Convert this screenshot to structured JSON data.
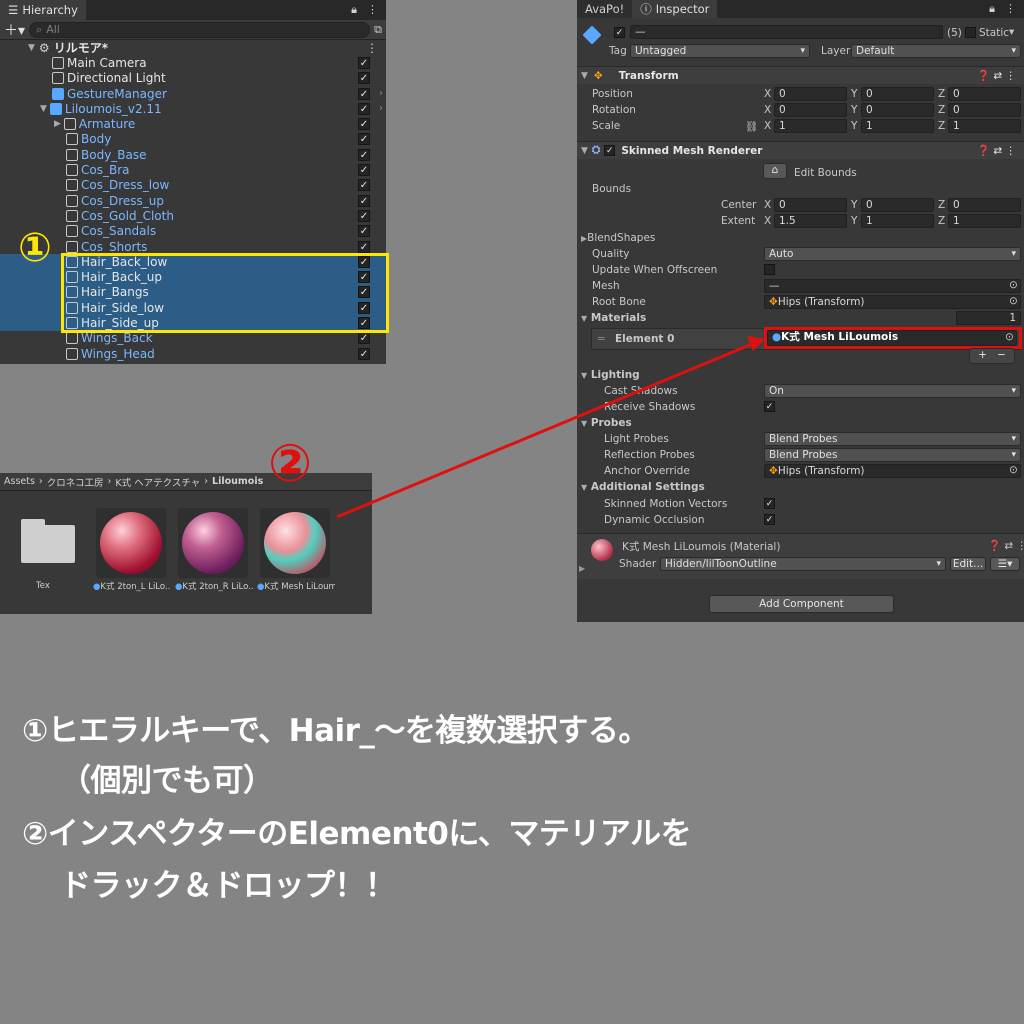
{
  "hierarchy": {
    "tab": "Hierarchy",
    "search_placeholder": "All",
    "scene": "リルモア*",
    "items": [
      {
        "label": "Main Camera"
      },
      {
        "label": "Directional Light"
      },
      {
        "label": "GestureManager"
      },
      {
        "label": "Liloumois_v2.11"
      },
      {
        "label": "Armature"
      },
      {
        "label": "Body"
      },
      {
        "label": "Body_Base"
      },
      {
        "label": "Cos_Bra"
      },
      {
        "label": "Cos_Dress_low"
      },
      {
        "label": "Cos_Dress_up"
      },
      {
        "label": "Cos_Gold_Cloth"
      },
      {
        "label": "Cos_Sandals"
      },
      {
        "label": "Cos_Shorts"
      },
      {
        "label": "Hair_Back_low"
      },
      {
        "label": "Hair_Back_up"
      },
      {
        "label": "Hair_Bangs"
      },
      {
        "label": "Hair_Side_low"
      },
      {
        "label": "Hair_Side_up"
      },
      {
        "label": "Wings_Back"
      },
      {
        "label": "Wings_Head"
      }
    ]
  },
  "inspector": {
    "tabs": [
      "AvaPo!",
      "Inspector"
    ],
    "object_name": "—",
    "count": "(5)",
    "static_label": "Static",
    "tag_label": "Tag",
    "tag_value": "Untagged",
    "layer_label": "Layer",
    "layer_value": "Default",
    "transform": {
      "title": "Transform",
      "position_label": "Position",
      "rotation_label": "Rotation",
      "scale_label": "Scale",
      "position": [
        "0",
        "0",
        "0"
      ],
      "rotation": [
        "0",
        "0",
        "0"
      ],
      "scale": [
        "1",
        "1",
        "1"
      ]
    },
    "smr": {
      "title": "Skinned Mesh Renderer",
      "edit_bounds": "Edit Bounds",
      "bounds": "Bounds",
      "center_label": "Center",
      "extent_label": "Extent",
      "center": [
        "0",
        "0",
        "0"
      ],
      "extent": [
        "1.5",
        "1",
        "1"
      ],
      "blendshapes": "BlendShapes",
      "quality_label": "Quality",
      "quality": "Auto",
      "update_offscreen": "Update When Offscreen",
      "mesh_label": "Mesh",
      "mesh": "—",
      "root_bone_label": "Root Bone",
      "root_bone": "Hips (Transform)",
      "materials_label": "Materials",
      "materials_count": "1",
      "element0_label": "Element 0",
      "element0": "K式 Mesh LiLoumois",
      "lighting": "Lighting",
      "cast_shadows_label": "Cast Shadows",
      "cast_shadows": "On",
      "receive_shadows_label": "Receive Shadows",
      "probes": "Probes",
      "light_probes_label": "Light Probes",
      "light_probes": "Blend Probes",
      "reflection_probes_label": "Reflection Probes",
      "reflection_probes": "Blend Probes",
      "anchor_override_label": "Anchor Override",
      "anchor_override": "Hips (Transform)",
      "additional": "Additional Settings",
      "motion_vectors_label": "Skinned Motion Vectors",
      "dynamic_occlusion_label": "Dynamic Occlusion"
    },
    "material": {
      "title": "K式 Mesh LiLoumois (Material)",
      "shader_label": "Shader",
      "shader": "Hidden/lilToonOutline",
      "edit": "Edit..."
    },
    "add_component": "Add Component"
  },
  "project": {
    "breadcrumb": [
      "Assets",
      "クロネコ工房",
      "K式 ヘアテクスチャ",
      "Liloumois"
    ],
    "assets": [
      {
        "label": "Tex"
      },
      {
        "label": "K式 2ton_L LiLo..."
      },
      {
        "label": "K式 2ton_R LiLo..."
      },
      {
        "label": "K式 Mesh LiLoum..."
      }
    ]
  },
  "annotations": {
    "marker1": "①",
    "marker2": "②",
    "line1": "①ヒエラルキーで、Hair_～を複数選択する。",
    "line2": "（個別でも可）",
    "line3": "②インスペクターのElement0に、マテリアルを",
    "line4": "ドラック＆ドロップ！！"
  },
  "colors": {
    "highlight_yellow": "#ffe600",
    "highlight_red": "#e01010",
    "selection_blue": "#2c5d87",
    "background": "#848484"
  }
}
